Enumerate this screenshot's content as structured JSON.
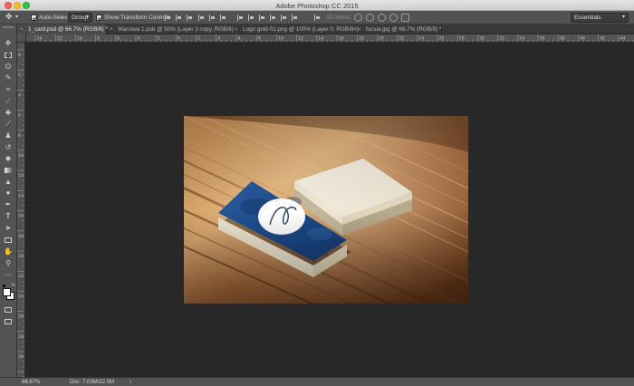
{
  "window": {
    "title": "Adobe Photoshop CC 2015"
  },
  "options_bar": {
    "auto_select_label": "Auto-Select:",
    "auto_select_value": "Group",
    "transform_controls_label": "Show Transform Controls",
    "mode_3d_label": "3D Mode:",
    "workspace": "Essentials"
  },
  "tabs": [
    {
      "label": "1_card.psd @ 66.7% (RGB/8) *",
      "active": true
    },
    {
      "label": "Warstwa 1.psb @ 50% (Layer 3 copy, RGB/8)",
      "active": false
    },
    {
      "label": "Logo gold-01.png @ 100% (Layer 0, RGB/8#)",
      "active": false
    },
    {
      "label": "fucsia.jpg @ 66.7% (RGB/8) *",
      "active": false
    }
  ],
  "ruler_h_labels": [
    "14",
    "12",
    "10",
    "8",
    "6",
    "4",
    "2",
    "0",
    "2",
    "4",
    "6",
    "8",
    "10",
    "12",
    "14",
    "16",
    "18",
    "20",
    "22",
    "24",
    "26",
    "28",
    "30",
    "32",
    "34",
    "36",
    "38",
    "40",
    "42",
    "44",
    "46"
  ],
  "ruler_v_labels": [
    "0",
    "2",
    "4",
    "6",
    "8",
    "10",
    "12",
    "14",
    "16",
    "18",
    "20",
    "22",
    "24",
    "26",
    "28",
    "30"
  ],
  "tools": [
    "move-tool",
    "marquee-tool",
    "lasso-tool",
    "quick-selection-tool",
    "crop-tool",
    "eyedropper-tool",
    "healing-brush-tool",
    "brush-tool",
    "clone-stamp-tool",
    "history-brush-tool",
    "eraser-tool",
    "gradient-tool",
    "blur-tool",
    "dodge-tool",
    "pen-tool",
    "type-tool",
    "path-selection-tool",
    "rectangle-tool",
    "hand-tool",
    "zoom-tool",
    "more-tools"
  ],
  "status": {
    "zoom": "66.67%",
    "doc": "Doc: 7.03M/22.0M"
  },
  "colors": {
    "card_blue": "#1f4f8f",
    "card_cream": "#f1ece0",
    "wood": "#b97a44"
  }
}
